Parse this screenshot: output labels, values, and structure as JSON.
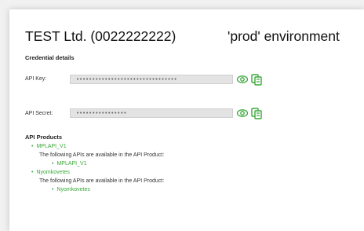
{
  "header": {
    "company": "TEST Ltd. (0022222222)",
    "environment": "'prod' environment"
  },
  "credentials": {
    "title": "Credential details",
    "api_key": {
      "label": "API Key:",
      "value": "••••••••••••••••••••••••••••••••",
      "show_icon": "eye-icon",
      "copy_icon": "copy-icon"
    },
    "api_secret": {
      "label": "API Secret:",
      "value": "••••••••••••••••",
      "show_icon": "eye-icon",
      "copy_icon": "copy-icon"
    }
  },
  "api_products": {
    "title": "API Products",
    "items": [
      {
        "name": "MPLAPI_V1",
        "note": "The following APIs are available in the API Product:",
        "apis": [
          "MPLAPI_V1"
        ]
      },
      {
        "name": "Nyomkovetes",
        "note": "The following APIs are available in the API Product:",
        "apis": [
          "Nyomkovetes"
        ]
      }
    ]
  },
  "colors": {
    "accent_green": "#3aa83a",
    "field_bg": "#e3e3e3"
  }
}
